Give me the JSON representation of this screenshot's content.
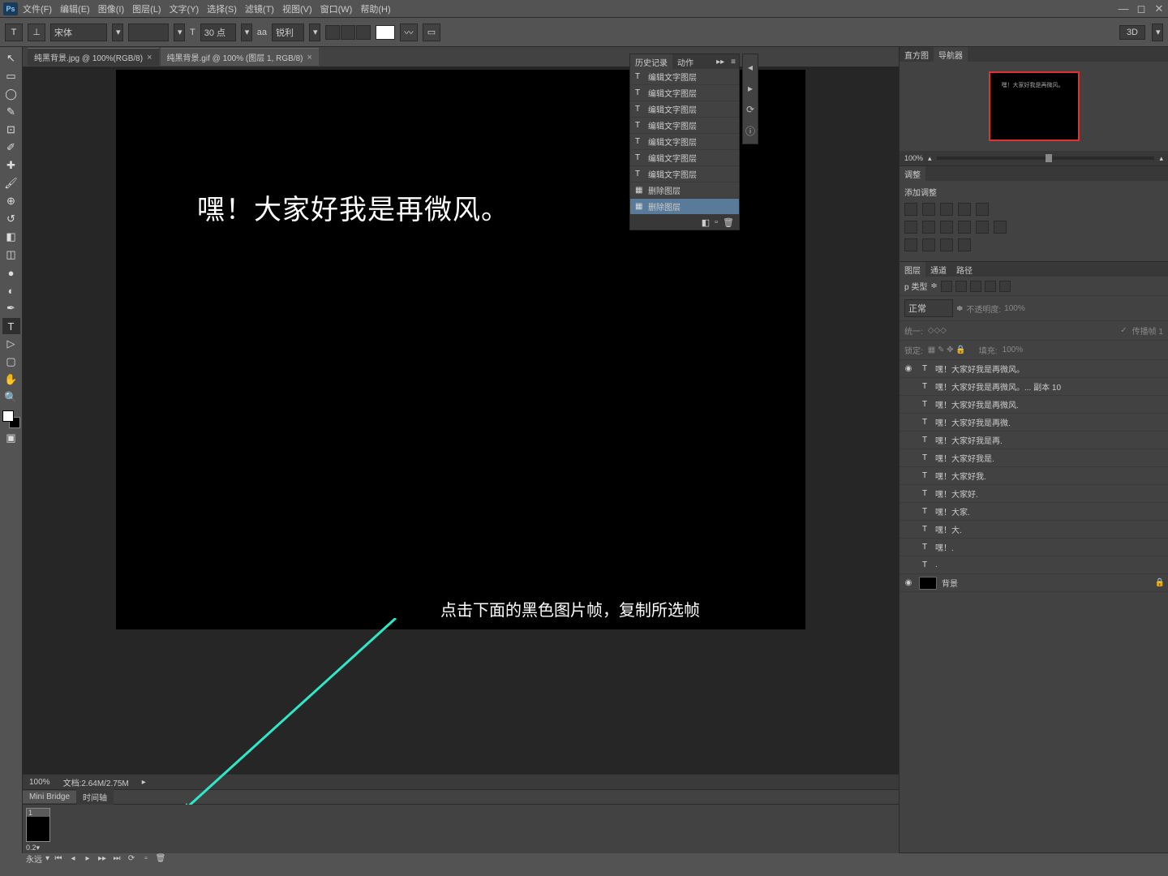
{
  "menu": [
    "文件(F)",
    "编辑(E)",
    "图像(I)",
    "图层(L)",
    "文字(Y)",
    "选择(S)",
    "滤镜(T)",
    "视图(V)",
    "窗口(W)",
    "帮助(H)"
  ],
  "options": {
    "font": "宋体",
    "size_label": "T",
    "size": "30 点",
    "aa_label": "aa",
    "aa": "锐利",
    "right_btn": "3D"
  },
  "tabs": [
    {
      "label": "纯黑背景.jpg @ 100%(RGB/8)",
      "active": true
    },
    {
      "label": "纯黑背景.gif @ 100% (图层 1, RGB/8)",
      "active": false
    }
  ],
  "canvas_text": "嘿！大家好我是再微风。",
  "instruction": "点击下面的黑色图片帧，复制所选帧",
  "status": {
    "zoom": "100%",
    "doc": "文档:2.64M/2.75M"
  },
  "bottom_tabs": [
    "Mini Bridge",
    "时间轴"
  ],
  "timeline": {
    "frame_num": "1",
    "frame_time": "0.2▾",
    "forever": "永远"
  },
  "history": {
    "tabs": [
      "历史记录",
      "动作"
    ],
    "items": [
      {
        "icon": "T",
        "label": "编辑文字图层"
      },
      {
        "icon": "T",
        "label": "编辑文字图层"
      },
      {
        "icon": "T",
        "label": "编辑文字图层"
      },
      {
        "icon": "T",
        "label": "编辑文字图层"
      },
      {
        "icon": "T",
        "label": "编辑文字图层"
      },
      {
        "icon": "T",
        "label": "编辑文字图层"
      },
      {
        "icon": "T",
        "label": "编辑文字图层"
      },
      {
        "icon": "▦",
        "label": "删除图层"
      },
      {
        "icon": "▦",
        "label": "删除图层",
        "sel": true
      }
    ]
  },
  "nav": {
    "tabs": [
      "直方图",
      "导航器"
    ],
    "zoom": "100%",
    "thumb_text": "嘿！大家好我是再微风。"
  },
  "adjustments": {
    "tab": "调整",
    "title": "添加调整"
  },
  "layers_panel": {
    "tabs": [
      "图层",
      "通道",
      "路径"
    ],
    "kind": "p 类型",
    "blend": "正常",
    "opacity_label": "不透明度:",
    "opacity": "100%",
    "unify": "统一:",
    "propagate": "传播帧 1",
    "lock": "锁定:",
    "fill_label": "填充:",
    "fill": "100%",
    "layers": [
      {
        "vis": "◉",
        "type": "T",
        "name": "嘿！大家好我是再微风。"
      },
      {
        "vis": "",
        "type": "T",
        "name": "嘿！大家好我是再微风。... 副本 10"
      },
      {
        "vis": "",
        "type": "T",
        "name": "嘿！大家好我是再微风."
      },
      {
        "vis": "",
        "type": "T",
        "name": "嘿！大家好我是再微."
      },
      {
        "vis": "",
        "type": "T",
        "name": "嘿！大家好我是再."
      },
      {
        "vis": "",
        "type": "T",
        "name": "嘿！大家好我是."
      },
      {
        "vis": "",
        "type": "T",
        "name": "嘿！大家好我."
      },
      {
        "vis": "",
        "type": "T",
        "name": "嘿！大家好."
      },
      {
        "vis": "",
        "type": "T",
        "name": "嘿！大家."
      },
      {
        "vis": "",
        "type": "T",
        "name": "嘿！大."
      },
      {
        "vis": "",
        "type": "T",
        "name": "嘿！."
      },
      {
        "vis": "",
        "type": "T",
        "name": "."
      },
      {
        "vis": "◉",
        "type": "bg",
        "name": "背景",
        "locked": true
      }
    ]
  }
}
